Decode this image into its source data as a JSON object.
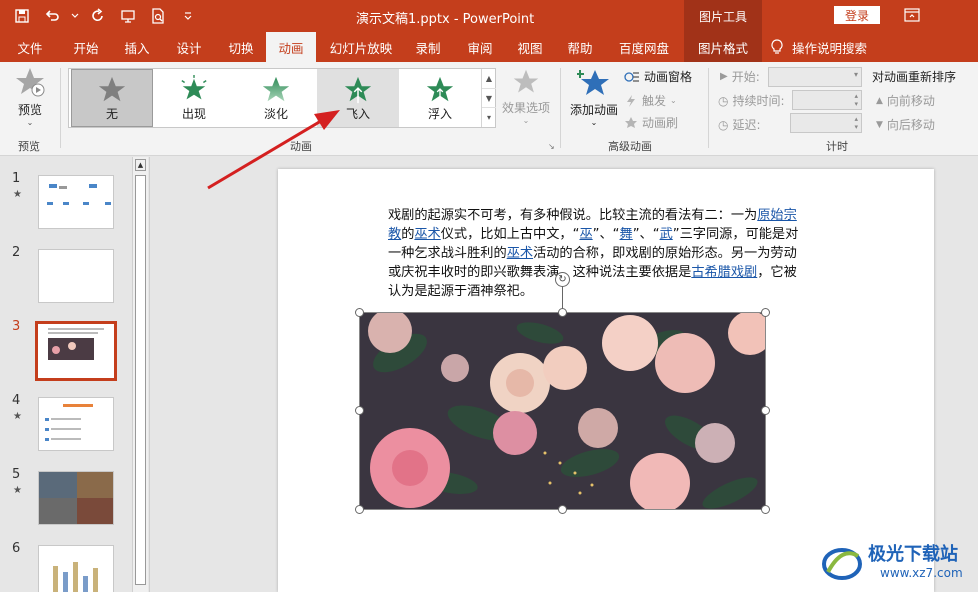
{
  "titlebar": {
    "title": "演示文稿1.pptx  -  PowerPoint",
    "context_tools": "图片工具",
    "login": "登录",
    "bg": "#c43e1c"
  },
  "tabs": [
    {
      "label": "文件"
    },
    {
      "label": "开始"
    },
    {
      "label": "插入"
    },
    {
      "label": "设计"
    },
    {
      "label": "切换"
    },
    {
      "label": "动画"
    },
    {
      "label": "幻灯片放映"
    },
    {
      "label": "录制"
    },
    {
      "label": "审阅"
    },
    {
      "label": "视图"
    },
    {
      "label": "帮助"
    },
    {
      "label": "百度网盘"
    },
    {
      "label": "图片格式"
    }
  ],
  "tell_me": "操作说明搜索",
  "ribbon": {
    "preview": "预览",
    "preview_group": "预览",
    "animation_group": "动画",
    "gallery": [
      {
        "label": "无"
      },
      {
        "label": "出现"
      },
      {
        "label": "淡化"
      },
      {
        "label": "飞入"
      },
      {
        "label": "浮入"
      }
    ],
    "effect_options": "效果选项",
    "add_animation": "添加动画",
    "animation_pane": "动画窗格",
    "trigger": "触发",
    "animation_painter": "动画刷",
    "advanced_group": "高级动画",
    "start_label": "开始:",
    "duration_label": "持续时间:",
    "delay_label": "延迟:",
    "timing_group": "计时",
    "reorder_title": "对动画重新排序",
    "move_earlier": "向前移动",
    "move_later": "向后移动"
  },
  "slides": [
    {
      "num": "1",
      "star": "★"
    },
    {
      "num": "2",
      "star": ""
    },
    {
      "num": "3",
      "star": ""
    },
    {
      "num": "4",
      "star": "★"
    },
    {
      "num": "5",
      "star": "★"
    },
    {
      "num": "6",
      "star": ""
    }
  ],
  "slide_body": {
    "p1": "戏剧的起源实不可考，有多种假说。比较主流的看法有二：一为",
    "l1": "原始宗教",
    "p2": "的",
    "l2": "巫术",
    "p3": "仪式，比如上古中文，“",
    "l3": "巫",
    "p4": "”、“",
    "l4": "舞",
    "p5": "”、“",
    "l5": "武",
    "p6": "”三字同源，可能是对一种乞求战斗胜利的",
    "l6": "巫术",
    "p7": "活动的合称，即戏剧的原始形态。另一为劳动或庆祝丰收时的即兴歌舞表演，这种说法主要依据是",
    "l7": "古希腊戏剧",
    "p8": "，它被认为是起源于酒神祭祀。"
  },
  "watermark": {
    "title": "极光下载站",
    "url": "www.xz7.com"
  }
}
